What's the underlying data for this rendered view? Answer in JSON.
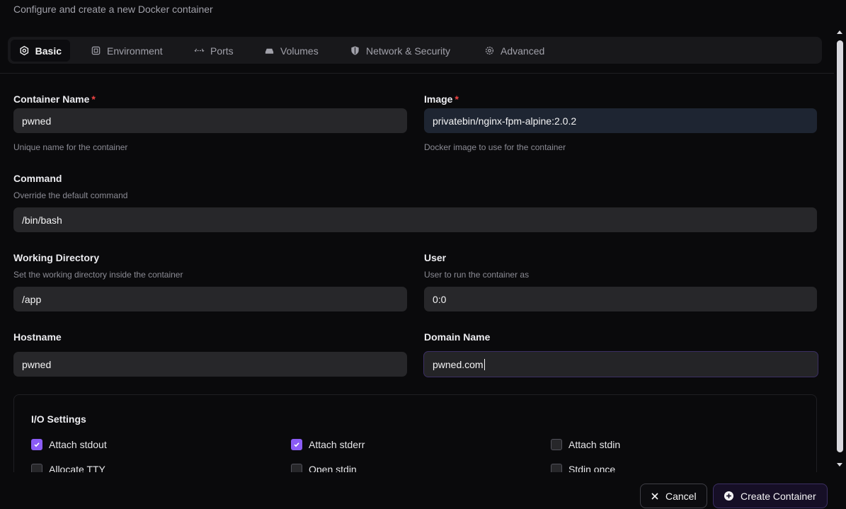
{
  "subtitle": "Configure and create a new Docker container",
  "tabs": [
    {
      "label": "Basic",
      "icon": "hexagon-gear-icon",
      "active": true
    },
    {
      "label": "Environment",
      "icon": "chip-icon"
    },
    {
      "label": "Ports",
      "icon": "arrows-horizontal-icon"
    },
    {
      "label": "Volumes",
      "icon": "hard-drive-icon"
    },
    {
      "label": "Network & Security",
      "icon": "shield-icon"
    },
    {
      "label": "Advanced",
      "icon": "gear-icon"
    }
  ],
  "form": {
    "container_name": {
      "label": "Container Name",
      "required": "*",
      "value": "pwned",
      "hint": "Unique name for the container"
    },
    "image": {
      "label": "Image",
      "required": "*",
      "value": "privatebin/nginx-fpm-alpine:2.0.2",
      "hint": "Docker image to use for the container"
    },
    "command": {
      "label": "Command",
      "hint": "Override the default command",
      "value": "/bin/bash"
    },
    "working_dir": {
      "label": "Working Directory",
      "hint": "Set the working directory inside the container",
      "value": "/app"
    },
    "user": {
      "label": "User",
      "hint": "User to run the container as",
      "value": "0:0"
    },
    "hostname": {
      "label": "Hostname",
      "value": "pwned"
    },
    "domain_name": {
      "label": "Domain Name",
      "value": "pwned.com"
    }
  },
  "io_settings": {
    "title": "I/O Settings",
    "options": [
      {
        "label": "Attach stdout",
        "checked": true
      },
      {
        "label": "Attach stderr",
        "checked": true
      },
      {
        "label": "Attach stdin",
        "checked": false
      },
      {
        "label": "Allocate TTY",
        "checked": false
      },
      {
        "label": "Open stdin",
        "checked": false
      },
      {
        "label": "Stdin once",
        "checked": false
      }
    ]
  },
  "buttons": {
    "cancel": "Cancel",
    "create": "Create Container"
  },
  "colors": {
    "accent": "#8b5cf6",
    "required": "#ef4444"
  }
}
